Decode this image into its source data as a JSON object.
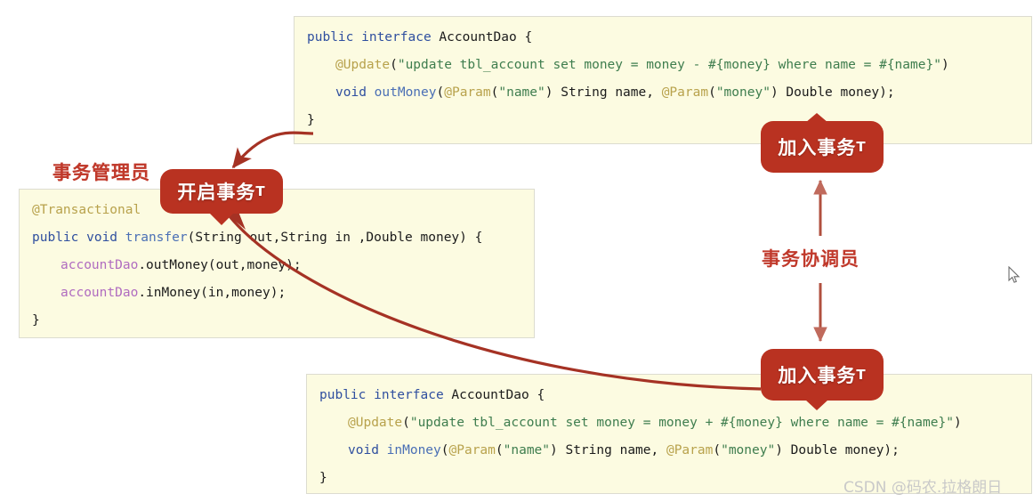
{
  "diagram": {
    "title": "Spring transaction propagation diagram",
    "accent_color": "#b93221",
    "label_color": "#c0392b",
    "code_bg": "#fcfbe1"
  },
  "code_blocks": {
    "top": {
      "name": "AccountDao outMoney interface",
      "lines": [
        [
          {
            "t": "public ",
            "c": "kw"
          },
          {
            "t": "interface ",
            "c": "kw"
          },
          {
            "t": "AccountDao {",
            "c": "pln"
          }
        ],
        [
          {
            "t": "@Update",
            "c": "ann"
          },
          {
            "t": "(",
            "c": "pln"
          },
          {
            "t": "\"update tbl_account set money = money - #{money} where name = #{name}\"",
            "c": "str"
          },
          {
            "t": ")",
            "c": "pln"
          }
        ],
        [
          {
            "t": "void ",
            "c": "kw"
          },
          {
            "t": "outMoney",
            "c": "mth"
          },
          {
            "t": "(",
            "c": "pln"
          },
          {
            "t": "@Param",
            "c": "ann"
          },
          {
            "t": "(",
            "c": "pln"
          },
          {
            "t": "\"name\"",
            "c": "str"
          },
          {
            "t": ") String name, ",
            "c": "pln"
          },
          {
            "t": "@Param",
            "c": "ann"
          },
          {
            "t": "(",
            "c": "pln"
          },
          {
            "t": "\"money\"",
            "c": "str"
          },
          {
            "t": ") Double money);",
            "c": "pln"
          }
        ],
        [
          {
            "t": "}",
            "c": "pln"
          }
        ]
      ],
      "indents": [
        0,
        1,
        1,
        0
      ]
    },
    "mid": {
      "name": "Transactional transfer method",
      "lines": [
        [
          {
            "t": "@Transactional",
            "c": "ann"
          }
        ],
        [
          {
            "t": "public ",
            "c": "kw"
          },
          {
            "t": "void ",
            "c": "kw"
          },
          {
            "t": "transfer",
            "c": "mth"
          },
          {
            "t": "(String out,String in ,Double money) {",
            "c": "pln"
          }
        ],
        [
          {
            "t": "accountDao",
            "c": "fld"
          },
          {
            "t": ".outMoney(out,money);",
            "c": "pln"
          }
        ],
        [
          {
            "t": "accountDao",
            "c": "fld"
          },
          {
            "t": ".inMoney(in,money);",
            "c": "pln"
          }
        ],
        [
          {
            "t": "}",
            "c": "pln"
          }
        ]
      ],
      "indents": [
        0,
        0,
        1,
        1,
        0
      ]
    },
    "bot": {
      "name": "AccountDao inMoney interface",
      "lines": [
        [
          {
            "t": "public ",
            "c": "kw"
          },
          {
            "t": "interface ",
            "c": "kw"
          },
          {
            "t": "AccountDao {",
            "c": "pln"
          }
        ],
        [
          {
            "t": "@Update",
            "c": "ann"
          },
          {
            "t": "(",
            "c": "pln"
          },
          {
            "t": "\"update tbl_account set money = money + #{money} where name = #{name}\"",
            "c": "str"
          },
          {
            "t": ")",
            "c": "pln"
          }
        ],
        [
          {
            "t": "void ",
            "c": "kw"
          },
          {
            "t": "inMoney",
            "c": "mth"
          },
          {
            "t": "(",
            "c": "pln"
          },
          {
            "t": "@Param",
            "c": "ann"
          },
          {
            "t": "(",
            "c": "pln"
          },
          {
            "t": "\"name\"",
            "c": "str"
          },
          {
            "t": ") String name, ",
            "c": "pln"
          },
          {
            "t": "@Param",
            "c": "ann"
          },
          {
            "t": "(",
            "c": "pln"
          },
          {
            "t": "\"money\"",
            "c": "str"
          },
          {
            "t": ") Double money);",
            "c": "pln"
          }
        ],
        [
          {
            "t": "}",
            "c": "pln"
          }
        ]
      ],
      "indents": [
        0,
        1,
        1,
        0
      ]
    }
  },
  "labels": {
    "transaction_manager": "事务管理员",
    "transaction_coordinator": "事务协调员"
  },
  "bubbles": {
    "start_transaction": {
      "main": "开启事务",
      "suffix": "T"
    },
    "join_transaction_top": {
      "main": "加入事务",
      "suffix": "T"
    },
    "join_transaction_bottom": {
      "main": "加入事务",
      "suffix": "T"
    }
  },
  "watermark": "CSDN @码农.拉格朗日",
  "icons": {
    "cursor": "mouse-pointer-icon"
  }
}
